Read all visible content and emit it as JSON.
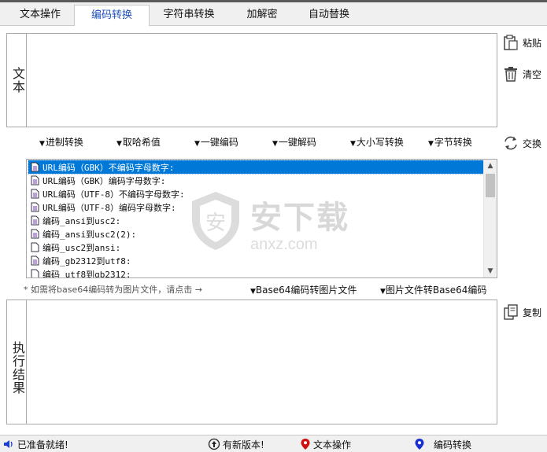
{
  "tabs": [
    {
      "label": "文本操作"
    },
    {
      "label": "编码转换",
      "active": true
    },
    {
      "label": "字符串转换"
    },
    {
      "label": "加解密"
    },
    {
      "label": "自动替换"
    }
  ],
  "input_section": {
    "label": "文本",
    "value": ""
  },
  "side_buttons": {
    "paste": "粘贴",
    "clear": "清空",
    "swap": "交换",
    "copy": "复制"
  },
  "menu_buttons": [
    {
      "label": "进制转换"
    },
    {
      "label": "取哈希值"
    },
    {
      "label": "一键编码"
    },
    {
      "label": "一键解码"
    },
    {
      "label": "大小写转换"
    },
    {
      "label": "字节转换"
    }
  ],
  "encoding_list": {
    "items": [
      {
        "label": "URL编码（GBK）不编码字母数字:",
        "selected": true
      },
      {
        "label": "URL编码（GBK）编码字母数字:"
      },
      {
        "label": "URL编码（UTF-8）不编码字母数字:"
      },
      {
        "label": "URL编码（UTF-8）编码字母数字:"
      },
      {
        "label": "编码_ansi到usc2:"
      },
      {
        "label": "编码_ansi到usc2(2):"
      },
      {
        "label": "编码_usc2到ansi:"
      },
      {
        "label": "编码_gb2312到utf8:"
      },
      {
        "label": "编码_utf8到gb2312:"
      }
    ]
  },
  "base64_row": {
    "hint": "* 如需将base64编码转为图片文件，请点击 →",
    "to_image": "Base64编码转图片文件",
    "to_base64": "图片文件转Base64编码"
  },
  "output_section": {
    "label": "执行结果",
    "value": ""
  },
  "status_bar": {
    "ready": "已准备就绪!",
    "new_version": "有新版本!",
    "text_ops": "文本操作",
    "encode_convert": "编码转换"
  },
  "watermark": {
    "title": "安下载",
    "url": "anxz.com"
  },
  "colors": {
    "accent": "#0078d7",
    "active_tab_text": "#1f4fbf",
    "status_pin": "#d01010",
    "status_pin2": "#1a2fd0"
  }
}
